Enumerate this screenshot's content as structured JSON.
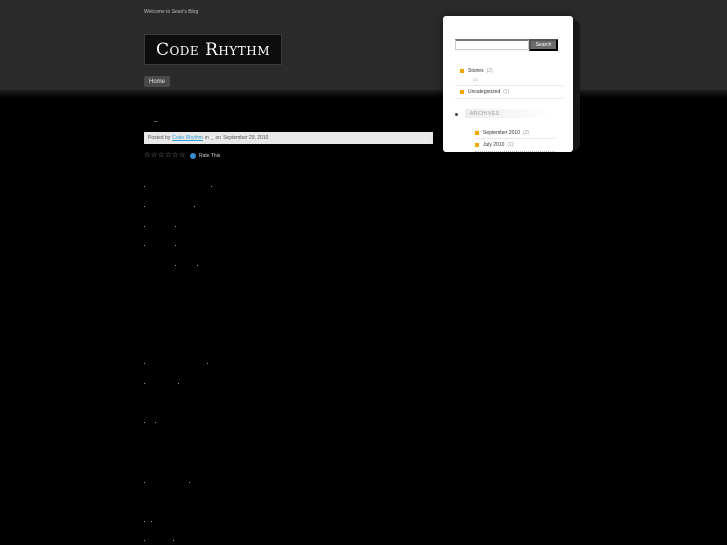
{
  "header": {
    "welcome": "Welcome to Sean's Blog",
    "logo": "Code Rhythm",
    "nav": [
      {
        "label": "Home"
      }
    ]
  },
  "post": {
    "title": "_",
    "meta": {
      "prefix": "Posted by",
      "author": "Code Rhythm",
      "in": "in",
      "category": "_",
      "date_prefix": "on",
      "date": "September 29, 2010"
    },
    "rating": {
      "label": "Rate This",
      "stars": 0,
      "max_stars": 6
    }
  },
  "sidebar": {
    "search": {
      "placeholder": "",
      "button": "Search"
    },
    "categories": [
      {
        "name": "Stories",
        "count": "(2)"
      },
      {
        "name": "Uncategorized",
        "count": "(1)"
      }
    ],
    "sub_count": "(2)",
    "archives": {
      "heading": "ARCHIVES",
      "items": [
        {
          "label": "September 2010",
          "count": "(2)"
        },
        {
          "label": "July 2010",
          "count": "(1)"
        }
      ]
    }
  },
  "colors": {
    "background": "#000000",
    "header": "#2b2b2b",
    "link": "#2a9fd6",
    "bullet": "#f0a500",
    "search_button": "#6b6b6b"
  }
}
